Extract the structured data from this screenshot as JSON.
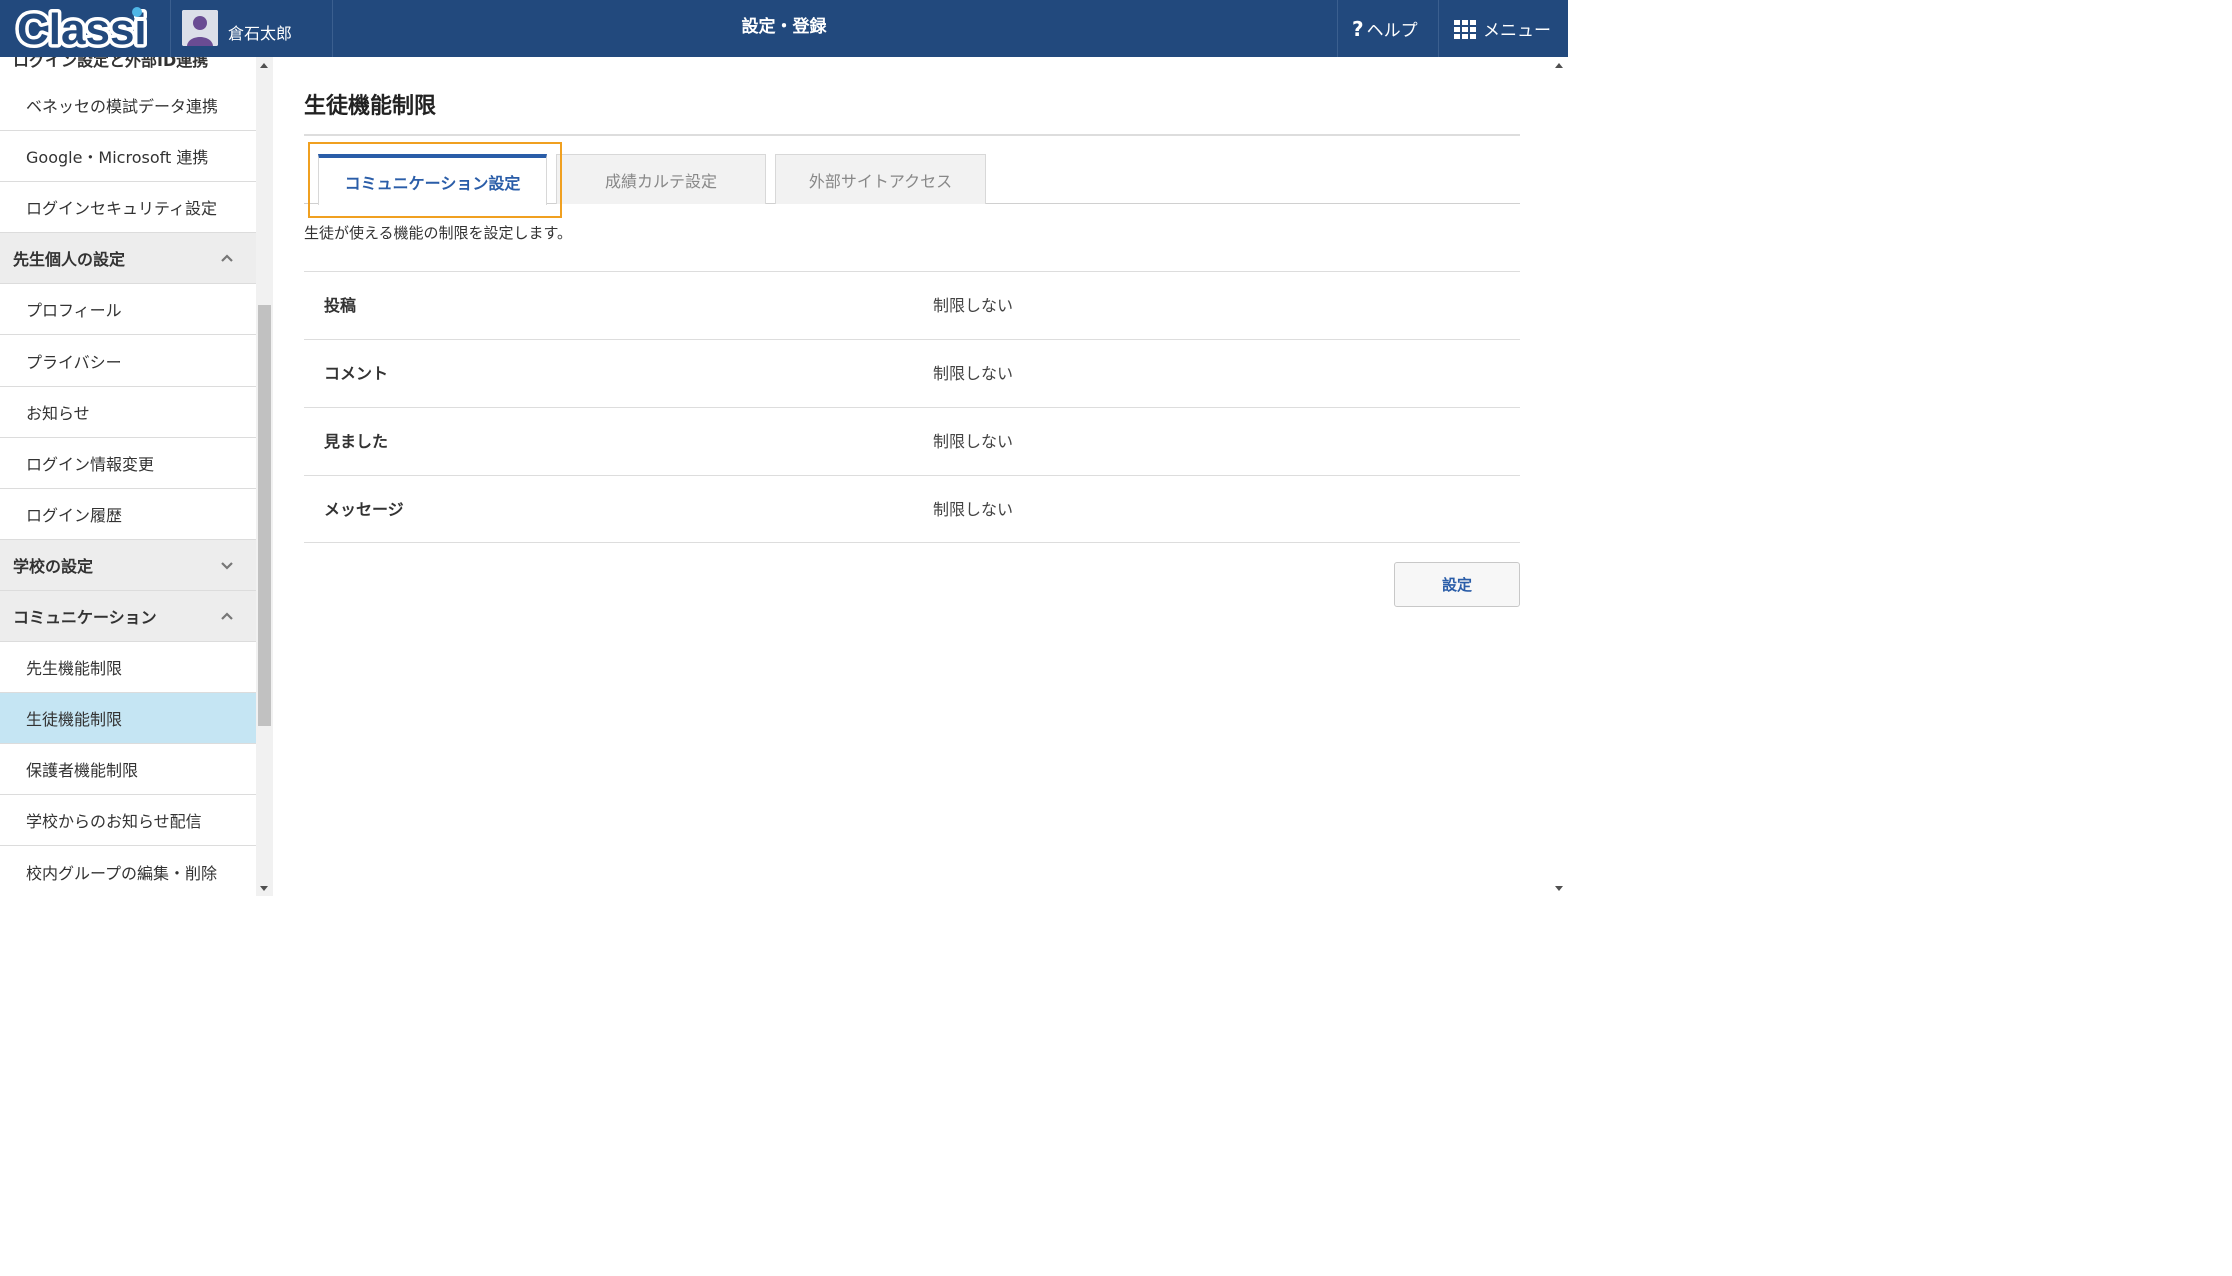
{
  "header": {
    "logo_text": "Classi",
    "user_name": "倉石太郎",
    "title": "設定・登録",
    "help_label": "ヘルプ",
    "menu_label": "メニュー",
    "accent": "#22497d"
  },
  "sidebar": {
    "cut_item": "ログイン設定と外部ID連携",
    "items": [
      {
        "label": "ベネッセの模試データ連携",
        "type": "item"
      },
      {
        "label": "Google・Microsoft 連携",
        "type": "item"
      },
      {
        "label": "ログインセキュリティ設定",
        "type": "item"
      },
      {
        "label": "先生個人の設定",
        "type": "section",
        "chevron": "chevron-up-icon"
      },
      {
        "label": "プロフィール",
        "type": "item"
      },
      {
        "label": "プライバシー",
        "type": "item"
      },
      {
        "label": "お知らせ",
        "type": "item"
      },
      {
        "label": "ログイン情報変更",
        "type": "item"
      },
      {
        "label": "ログイン履歴",
        "type": "item"
      },
      {
        "label": "学校の設定",
        "type": "section",
        "chevron": "chevron-down-icon"
      },
      {
        "label": "コミュニケーション",
        "type": "section",
        "chevron": "chevron-up-icon"
      },
      {
        "label": "先生機能制限",
        "type": "item"
      },
      {
        "label": "生徒機能制限",
        "type": "item",
        "active": true
      },
      {
        "label": "保護者機能制限",
        "type": "item"
      },
      {
        "label": "学校からのお知らせ配信",
        "type": "item"
      },
      {
        "label": "校内グループの編集・削除",
        "type": "item"
      }
    ]
  },
  "main": {
    "title": "生徒機能制限",
    "tabs": [
      {
        "label": "コミュニケーション設定",
        "active": true
      },
      {
        "label": "成績カルテ設定",
        "active": false
      },
      {
        "label": "外部サイトアクセス",
        "active": false
      }
    ],
    "description": "生徒が使える機能の制限を設定します。",
    "rows": [
      {
        "label": "投稿",
        "value": "制限しない"
      },
      {
        "label": "コメント",
        "value": "制限しない"
      },
      {
        "label": "見ました",
        "value": "制限しない"
      },
      {
        "label": "メッセージ",
        "value": "制限しない"
      }
    ],
    "submit_label": "設定"
  }
}
